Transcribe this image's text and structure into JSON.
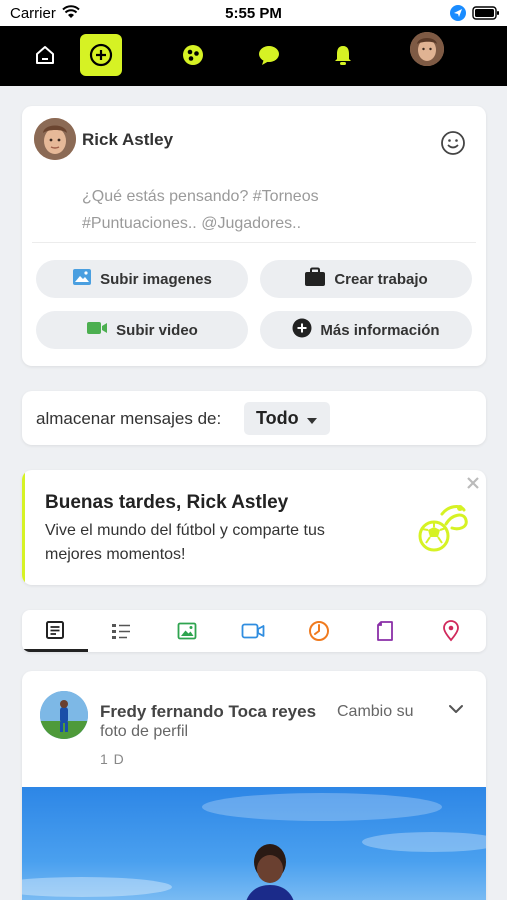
{
  "status_bar": {
    "carrier": "Carrier",
    "time": "5:55 PM"
  },
  "nav": {
    "items": [
      "home-icon",
      "add-post-icon",
      "football-icon",
      "chat-icon",
      "bell-icon",
      "profile-avatar"
    ],
    "accent": "#d6f224"
  },
  "composer": {
    "user_name": "Rick Astley",
    "placeholder_line1": "¿Qué estás pensando? #Torneos",
    "placeholder_line2": "#Puntuaciones.. @Jugadores..",
    "buttons": {
      "upload_images": "Subir imagenes",
      "create_job": "Crear trabajo",
      "upload_video": "Subir video",
      "more_info": "Más información"
    }
  },
  "filter": {
    "label": "almacenar mensajes de:",
    "selected": "Todo"
  },
  "greeting": {
    "title": "Buenas tardes, Rick Astley",
    "line1": "Vive el mundo del fútbol y comparte tus",
    "line2": "mejores momentos!"
  },
  "tabs": [
    "feed-icon",
    "list-icon",
    "image-icon",
    "video-icon",
    "clock-icon",
    "document-icon",
    "location-icon"
  ],
  "post": {
    "author": "Fredy fernando Toca reyes",
    "action_part1": "Cambio su",
    "action_part2": "foto de perfil",
    "time": "1 D"
  },
  "colors": {
    "image_icon": "#4a9fe0",
    "video_icon": "#4caf50",
    "tab_image": "#2ea44f",
    "tab_video": "#2f8de0",
    "tab_clock": "#f07a1e",
    "tab_doc": "#8a2fa8",
    "tab_location": "#d02a5c"
  }
}
